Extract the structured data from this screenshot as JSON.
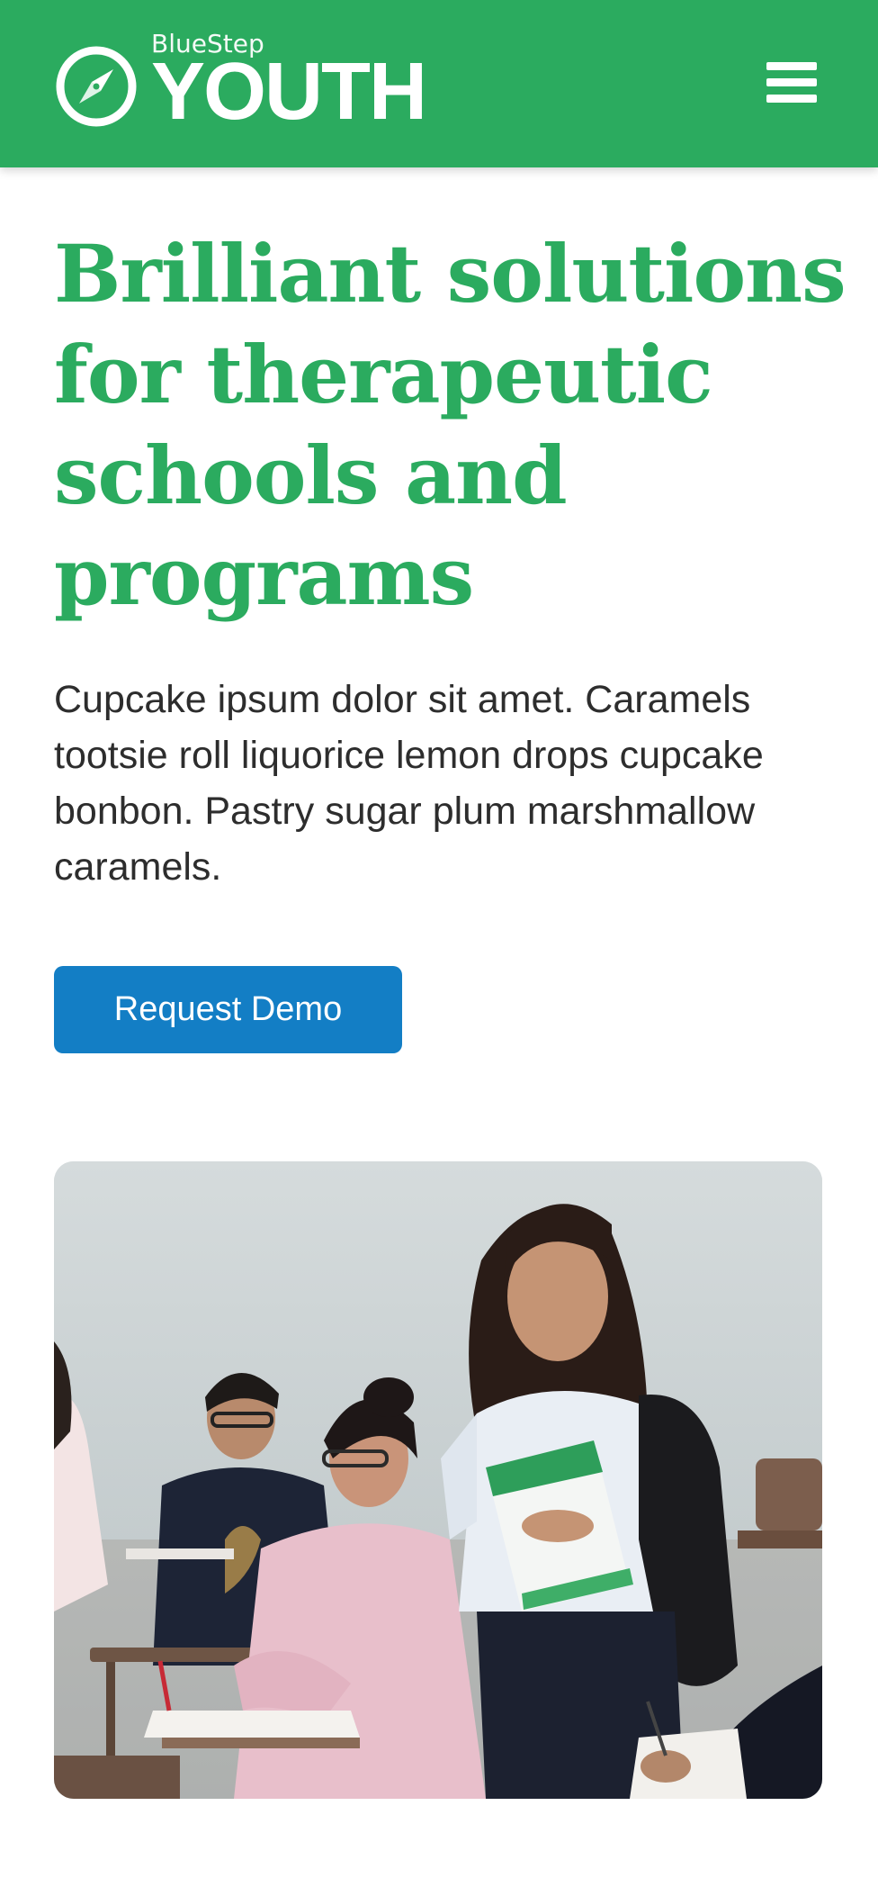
{
  "header": {
    "logo": {
      "small_text": "BlueStep",
      "big_text": "YOUTH",
      "icon": "compass-icon"
    },
    "menu_icon": "hamburger-menu-icon"
  },
  "hero": {
    "title": "Brilliant solutions for therapeutic schools and programs",
    "description": "Cupcake ipsum dolor sit amet. Caramels tootsie roll liquorice lemon drops cupcake bonbon. Pastry sugar plum marshmallow caramels.",
    "cta_label": "Request Demo"
  },
  "photo": {
    "subject": "students-in-classroom-photo"
  },
  "colors": {
    "brand_green": "#2bab5f",
    "button_blue": "#137ec5",
    "body_text": "#2d2d2d",
    "white": "#ffffff"
  }
}
